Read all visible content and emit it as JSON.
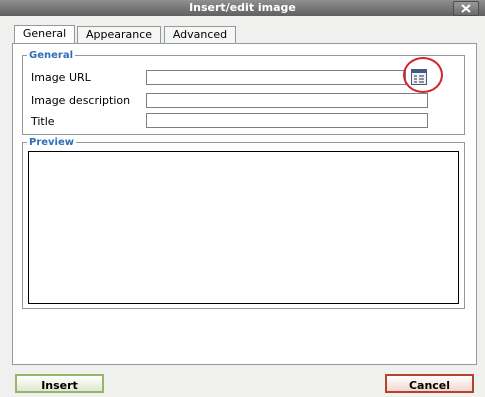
{
  "dialog": {
    "title": "Insert/edit image"
  },
  "tabs": [
    {
      "label": "General",
      "active": true
    },
    {
      "label": "Appearance",
      "active": false
    },
    {
      "label": "Advanced",
      "active": false
    }
  ],
  "general": {
    "legend": "General",
    "fields": {
      "image_url": {
        "label": "Image URL",
        "value": ""
      },
      "image_description": {
        "label": "Image description",
        "value": ""
      },
      "title": {
        "label": "Title",
        "value": ""
      }
    },
    "browse_icon": "browse-list-icon"
  },
  "preview": {
    "legend": "Preview"
  },
  "buttons": {
    "insert": "Insert",
    "cancel": "Cancel"
  },
  "colors": {
    "legend": "#2b6fb6",
    "annotation_circle": "#d2232a",
    "insert_border": "#97b66b",
    "cancel_border": "#b5432c"
  }
}
